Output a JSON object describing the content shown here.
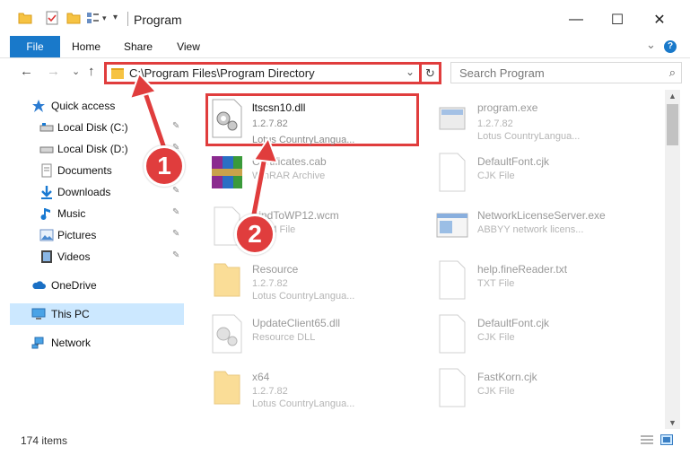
{
  "window": {
    "title": "Program",
    "minimize": "—",
    "maximize": "☐",
    "close": "✕"
  },
  "ribbon": {
    "tabs": [
      "File",
      "Home",
      "Share",
      "View"
    ],
    "expand": "⌄",
    "help": "?"
  },
  "nav": {
    "back": "←",
    "forward": "→",
    "recent": "⌄",
    "up": "↑",
    "address": "C:\\Program Files\\Program Directory",
    "address_dropdown": "⌄",
    "refresh": "↻",
    "search_placeholder": "Search Program",
    "search_icon": "⌕"
  },
  "sidebar": {
    "items": [
      {
        "label": "Quick access",
        "icon": "star-icon",
        "pinned": false
      },
      {
        "label": "Local Disk (C:)",
        "icon": "drive-icon",
        "pinned": true
      },
      {
        "label": "Local Disk (D:)",
        "icon": "drive-icon",
        "pinned": true
      },
      {
        "label": "Documents",
        "icon": "documents-icon",
        "pinned": true
      },
      {
        "label": "Downloads",
        "icon": "downloads-icon",
        "pinned": true
      },
      {
        "label": "Music",
        "icon": "music-icon",
        "pinned": true
      },
      {
        "label": "Pictures",
        "icon": "pictures-icon",
        "pinned": true
      },
      {
        "label": "Videos",
        "icon": "videos-icon",
        "pinned": true
      },
      {
        "label": "OneDrive",
        "icon": "cloud-icon",
        "pinned": false
      },
      {
        "label": "This PC",
        "icon": "computer-icon",
        "pinned": false,
        "selected": true
      },
      {
        "label": "Network",
        "icon": "network-icon",
        "pinned": false
      }
    ],
    "pin_glyph": "📌"
  },
  "files": [
    {
      "name": "ltscsn10.dll",
      "line1": "1.2.7.82",
      "line2": "Lotus CountryLangua...",
      "icon": "dll-icon",
      "highlighted": true
    },
    {
      "name": "program.exe",
      "line1": "1.2.7.82",
      "line2": "Lotus CountryLangua...",
      "icon": "exe-icon"
    },
    {
      "name": "Certificates.cab",
      "line1": "WinRAR Archive",
      "line2": "",
      "icon": "archive-icon"
    },
    {
      "name": "DefaultFont.cjk",
      "line1": "CJK File",
      "line2": "",
      "icon": "file-icon"
    },
    {
      "name": "FindToWP12.wcm",
      "line1": "WCM File",
      "line2": "",
      "icon": "file-icon"
    },
    {
      "name": "NetworkLicenseServer.exe",
      "line1": "ABBYY network licens...",
      "line2": "",
      "icon": "app-icon"
    },
    {
      "name": "Resource",
      "line1": "1.2.7.82",
      "line2": "Lotus CountryLangua...",
      "icon": "folder-icon"
    },
    {
      "name": "help.fineReader.txt",
      "line1": "TXT File",
      "line2": "",
      "icon": "file-icon"
    },
    {
      "name": "UpdateClient65.dll",
      "line1": "Resource DLL",
      "line2": "",
      "icon": "dll-icon"
    },
    {
      "name": "DefaultFont.cjk",
      "line1": "CJK File",
      "line2": "",
      "icon": "file-icon"
    },
    {
      "name": "x64",
      "line1": "1.2.7.82",
      "line2": "Lotus CountryLangua...",
      "icon": "folder-icon"
    },
    {
      "name": "FastKorn.cjk",
      "line1": "CJK File",
      "line2": "",
      "icon": "file-icon"
    }
  ],
  "status": {
    "count": "174 items"
  },
  "annotations": {
    "step1": "1",
    "step2": "2"
  },
  "colors": {
    "accent": "#1979ca",
    "highlight": "#e03d3d",
    "selected": "#cce8ff"
  }
}
